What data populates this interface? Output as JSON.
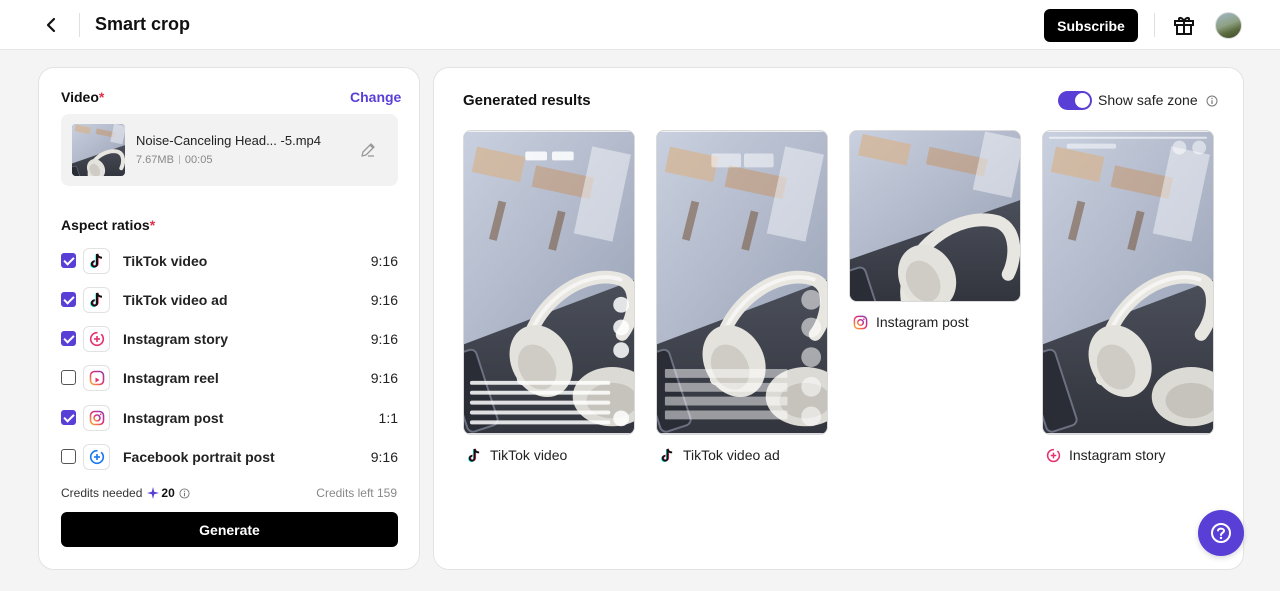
{
  "header": {
    "title": "Smart crop",
    "subscribe_label": "Subscribe"
  },
  "video": {
    "label": "Video",
    "required_mark": "*",
    "change_label": "Change",
    "file_name": "Noise-Canceling Head...  -5.mp4",
    "size": "7.67MB",
    "duration": "00:05"
  },
  "aspect": {
    "label": "Aspect ratios",
    "required_mark": "*",
    "items": [
      {
        "name": "TikTok video",
        "ratio": "9:16",
        "checked": true,
        "icon": "tiktok-icon"
      },
      {
        "name": "TikTok video ad",
        "ratio": "9:16",
        "checked": true,
        "icon": "tiktok-icon"
      },
      {
        "name": "Instagram story",
        "ratio": "9:16",
        "checked": true,
        "icon": "instagram-story-icon"
      },
      {
        "name": "Instagram reel",
        "ratio": "9:16",
        "checked": false,
        "icon": "instagram-reel-icon"
      },
      {
        "name": "Instagram post",
        "ratio": "1:1",
        "checked": true,
        "icon": "instagram-icon"
      },
      {
        "name": "Facebook portrait post",
        "ratio": "9:16",
        "checked": false,
        "icon": "facebook-story-icon"
      }
    ]
  },
  "credits": {
    "needed_label": "Credits needed",
    "needed_value": "20",
    "left_label": "Credits left 159"
  },
  "generate_label": "Generate",
  "results": {
    "title": "Generated results",
    "safe_zone_label": "Show safe zone",
    "safe_zone_on": true,
    "cards": [
      {
        "label": "TikTok video",
        "icon": "tiktok-icon"
      },
      {
        "label": "TikTok video ad",
        "icon": "tiktok-icon"
      },
      {
        "label": "Instagram post",
        "icon": "instagram-icon"
      },
      {
        "label": "Instagram story",
        "icon": "instagram-story-icon"
      }
    ]
  },
  "colors": {
    "accent": "#5a3fd6",
    "required": "#e0304a",
    "button_dark": "#000000"
  }
}
